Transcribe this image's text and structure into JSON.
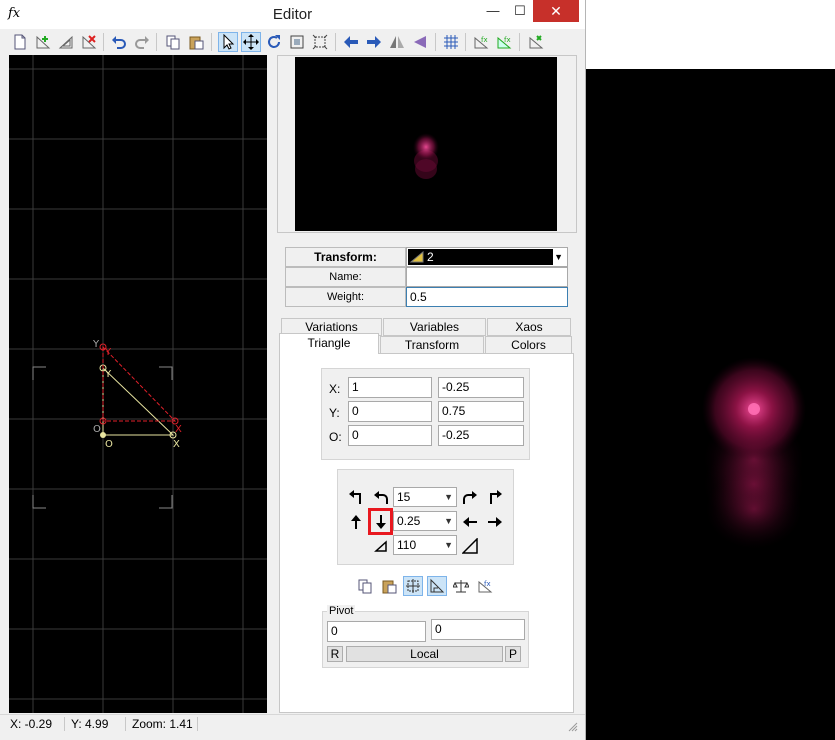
{
  "window": {
    "app_icon_text": "fx",
    "title": "Editor",
    "minimize_glyph": "—",
    "maximize_glyph": "☐",
    "close_glyph": "✕"
  },
  "toolbar": {
    "icons": [
      "new-icon",
      "add-icon",
      "duplicate-icon",
      "delete-icon",
      "undo-icon",
      "redo-icon",
      "copy-icon",
      "paste-icon",
      "select-icon",
      "move-icon",
      "rotate-icon",
      "scale-icon",
      "fit-icon",
      "flip-left-icon",
      "flip-right-icon",
      "mirror-h-icon",
      "mirror-v-icon",
      "grid-icon",
      "variation-icon",
      "post-transform-icon",
      "reset-icon"
    ],
    "pressed": [
      "select-icon",
      "move-icon"
    ]
  },
  "transform": {
    "label": "Transform:",
    "selected": "2",
    "name_label": "Name:",
    "name_value": "",
    "weight_label": "Weight:",
    "weight_value": "0.5"
  },
  "tabs": {
    "top_row": [
      "Variations",
      "Variables",
      "Xaos"
    ],
    "bottom_row": [
      "Triangle",
      "Transform",
      "Colors"
    ],
    "active": "Triangle"
  },
  "triangle": {
    "x_label": "X:",
    "y_label": "Y:",
    "o_label": "O:",
    "x_values": [
      "1",
      "-0.25"
    ],
    "y_values": [
      "0",
      "0.75"
    ],
    "o_values": [
      "0",
      "-0.25"
    ]
  },
  "controls": {
    "rotate_value": "15",
    "move_value": "0.25",
    "scale_value": "110"
  },
  "pivot": {
    "title": "Pivot",
    "x": "0",
    "y": "0",
    "reset_label": "R",
    "mode_label": "Local",
    "pick_label": "P"
  },
  "status": {
    "x": "X: -0.29",
    "y": "Y: 4.99",
    "zoom": "Zoom: 1.41"
  },
  "canvas_labels": {
    "x": "X",
    "y": "Y",
    "o": "O"
  },
  "colors": {
    "accent": "#cce4f7",
    "close_red": "#c7302a",
    "triangle_red": "#e0202a",
    "triangle_yellow": "#e8e4a0",
    "flame_pink": "#e8367a"
  }
}
